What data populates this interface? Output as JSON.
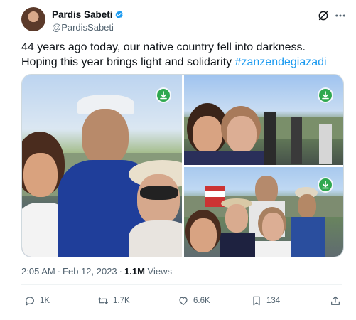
{
  "author": {
    "name": "Pardis Sabeti",
    "handle": "@PardisSabeti"
  },
  "tweet": {
    "text": "44 years ago today, our native country fell into darkness. Hoping this year brings light and solidarity ",
    "hashtag": "#zanzendegiazadi"
  },
  "meta": {
    "time": "2:05 AM",
    "dot": "·",
    "date": "Feb 12, 2023",
    "views_count": "1.1M",
    "views_label": "Views"
  },
  "actions": {
    "replies": "1K",
    "reposts": "1.7K",
    "likes": "6.6K",
    "bookmarks": "134"
  },
  "icons": {
    "verified": "verified-badge-icon",
    "grok": "grok-icon",
    "more": "more-icon",
    "download": "download-icon",
    "reply": "reply-icon",
    "retweet": "retweet-icon",
    "like": "heart-icon",
    "bookmark": "bookmark-icon",
    "share": "share-icon"
  },
  "colors": {
    "accent": "#1d9bf0",
    "secondary_text": "#536471",
    "download_badge": "#2fa84f"
  }
}
